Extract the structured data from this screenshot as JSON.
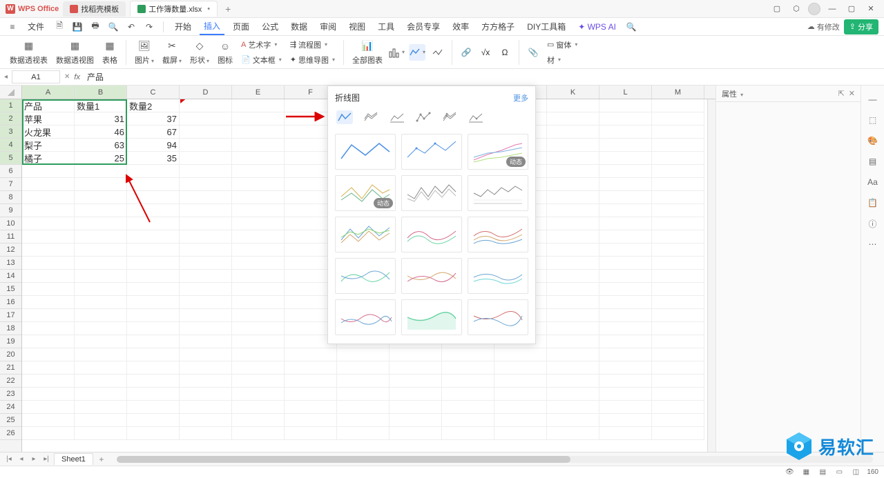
{
  "app": {
    "name": "WPS Office"
  },
  "tabs": [
    {
      "label": "找稻壳模板",
      "iconColor": "red"
    },
    {
      "label": "工作簿数量.xlsx",
      "iconColor": "green",
      "active": true,
      "dirty": "•"
    }
  ],
  "menus": {
    "file": "文件",
    "items": [
      "开始",
      "插入",
      "页面",
      "公式",
      "数据",
      "审阅",
      "视图",
      "工具",
      "会员专享",
      "效率",
      "方方格子",
      "DIY工具箱"
    ],
    "wpsai": "WPS AI",
    "modified": "有修改",
    "share": "分享"
  },
  "ribbon": {
    "pivot_table": "数据透视表",
    "pivot_chart": "数据透视图",
    "table": "表格",
    "picture": "图片",
    "screenshot": "截屏",
    "shape": "形状",
    "icon": "图标",
    "art_text": "艺术字",
    "flowchart": "流程图",
    "textbox": "文本框",
    "mindmap": "思维导图",
    "all_charts": "全部图表",
    "funnel": "窗体",
    "material": "材"
  },
  "chart_panel": {
    "title": "折线图",
    "more": "更多",
    "badge_dynamic": "动态"
  },
  "name_box": "A1",
  "formula": "产品",
  "columns": [
    "A",
    "B",
    "C",
    "D",
    "E",
    "F",
    "G",
    "H",
    "I",
    "J",
    "K",
    "L",
    "M"
  ],
  "rows_count": 26,
  "data": {
    "headers": [
      "产品",
      "数量1",
      "数量2"
    ],
    "rows": [
      [
        "苹果",
        "31",
        "37"
      ],
      [
        "火龙果",
        "46",
        "67"
      ],
      [
        "梨子",
        "63",
        "94"
      ],
      [
        "橘子",
        "25",
        "35"
      ]
    ]
  },
  "chart_data": {
    "type": "table",
    "categories": [
      "苹果",
      "火龙果",
      "梨子",
      "橘子"
    ],
    "series": [
      {
        "name": "数量1",
        "values": [
          31,
          46,
          63,
          25
        ]
      },
      {
        "name": "数量2",
        "values": [
          37,
          67,
          94,
          35
        ]
      }
    ],
    "title": "",
    "xlabel": "产品",
    "ylabel": ""
  },
  "prop_panel": {
    "title": "属性"
  },
  "sheet": {
    "name": "Sheet1"
  },
  "status": {
    "zoom": "160"
  },
  "watermark": "易软汇"
}
